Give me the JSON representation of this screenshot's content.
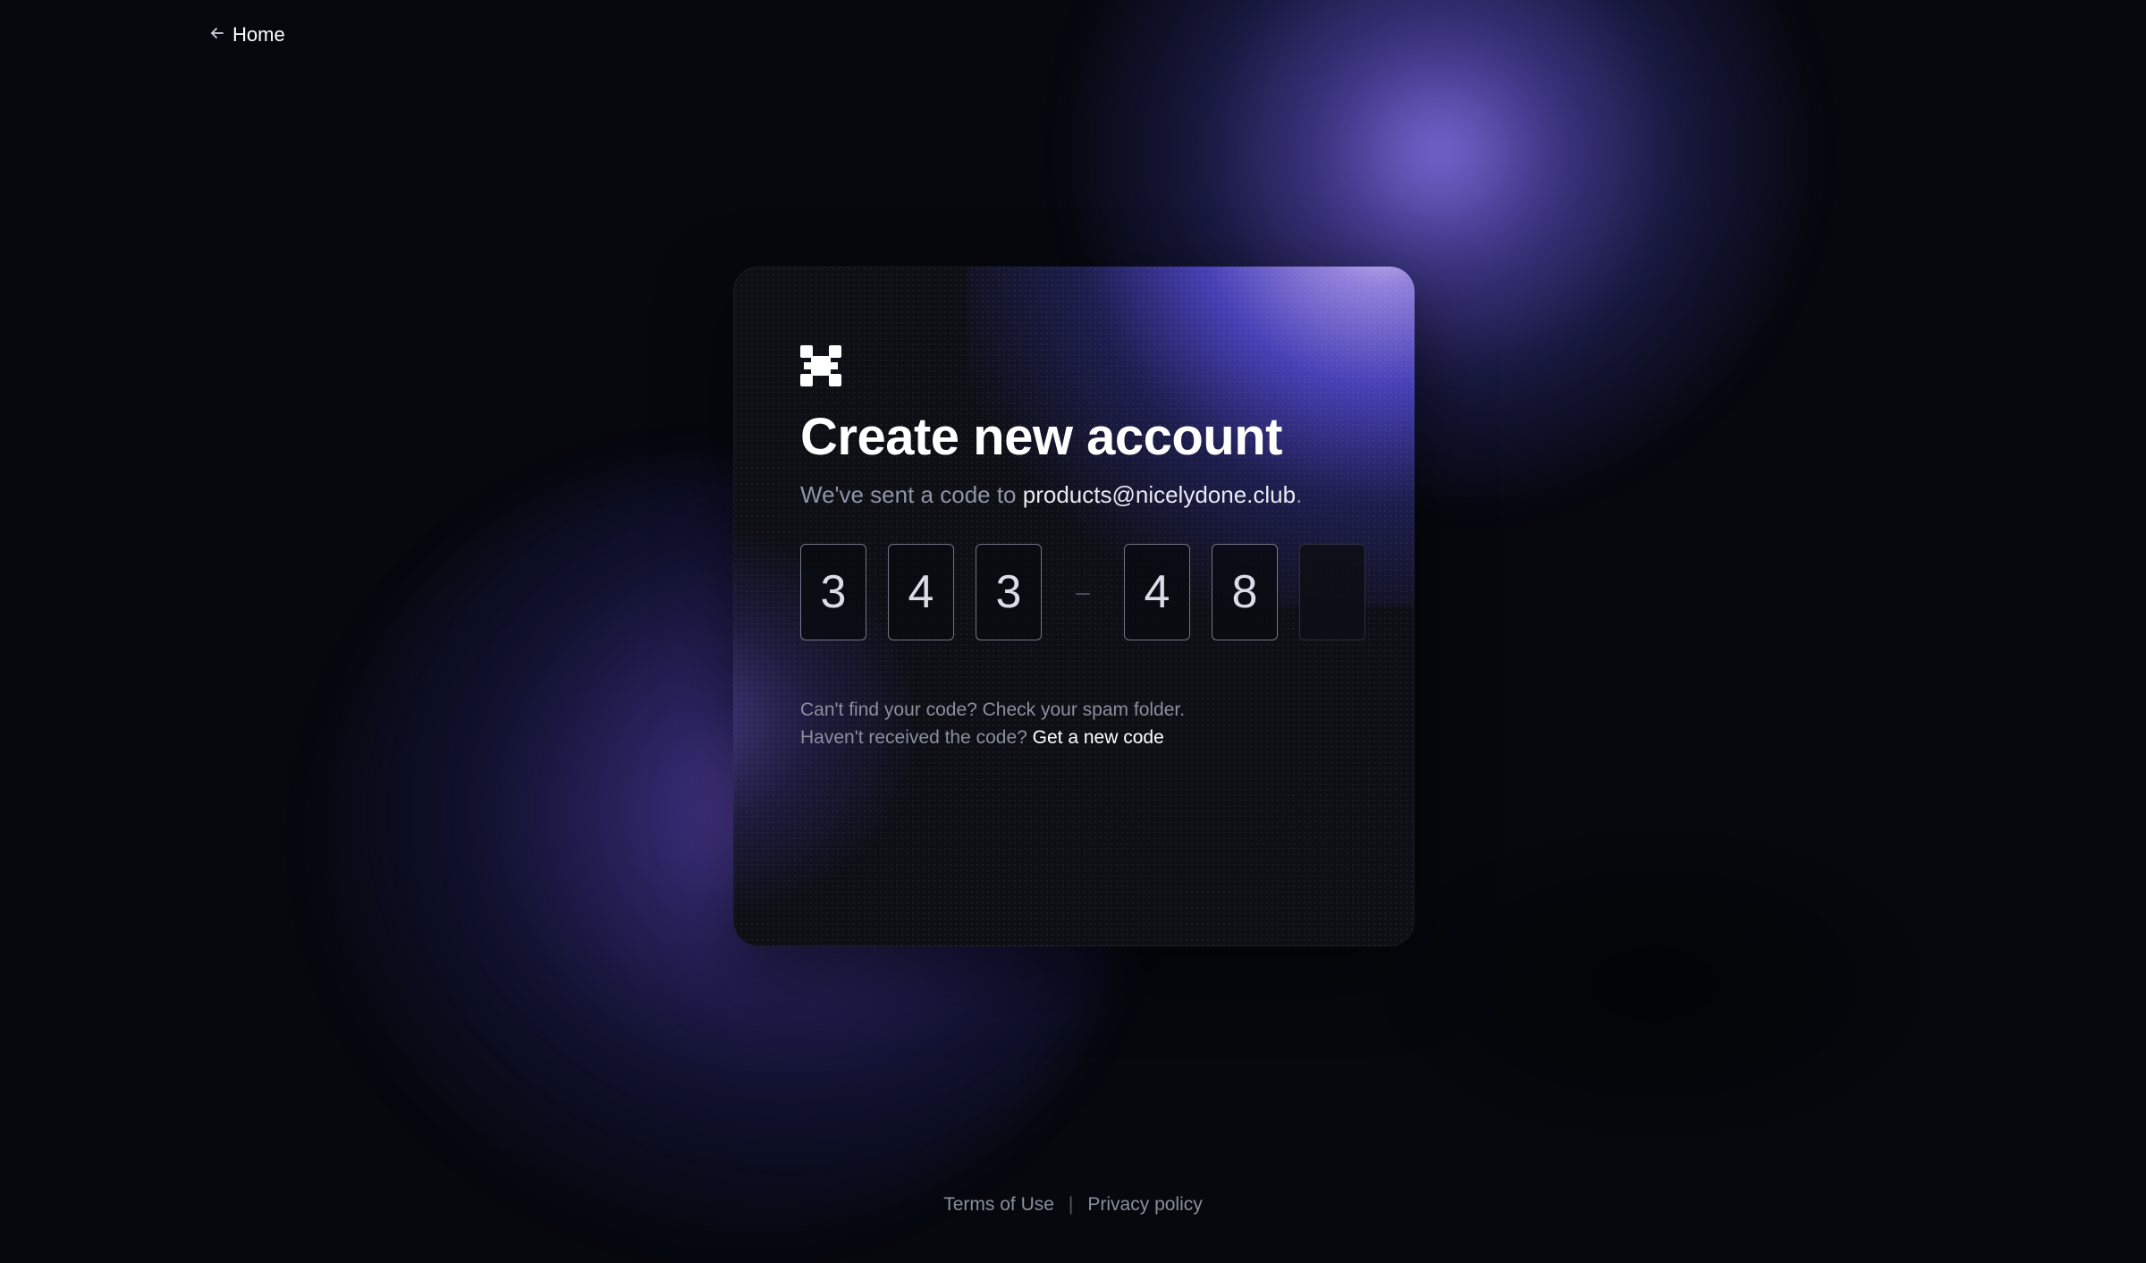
{
  "nav": {
    "back_label": "Home"
  },
  "card": {
    "title": "Create new account",
    "subtitle_prefix": "We've sent a code to ",
    "email": "products@nicelydone.club",
    "subtitle_suffix": ".",
    "code_digits": [
      "3",
      "4",
      "3",
      "4",
      "8",
      ""
    ],
    "code_separator": "–",
    "help_line1": "Can't find your code? Check your spam folder.",
    "help_line2_prefix": "Haven't received the code? ",
    "help_line2_link": "Get a new code"
  },
  "footer": {
    "terms": "Terms of Use",
    "separator": "|",
    "privacy": "Privacy policy"
  },
  "colors": {
    "background": "#06080e",
    "card": "#0d0f15",
    "accent": "#6a5cf0",
    "text_primary": "#ffffff",
    "text_muted": "#8a8f9e"
  },
  "icons": {
    "back": "arrow-left-icon",
    "logo": "brand-logo-icon"
  }
}
